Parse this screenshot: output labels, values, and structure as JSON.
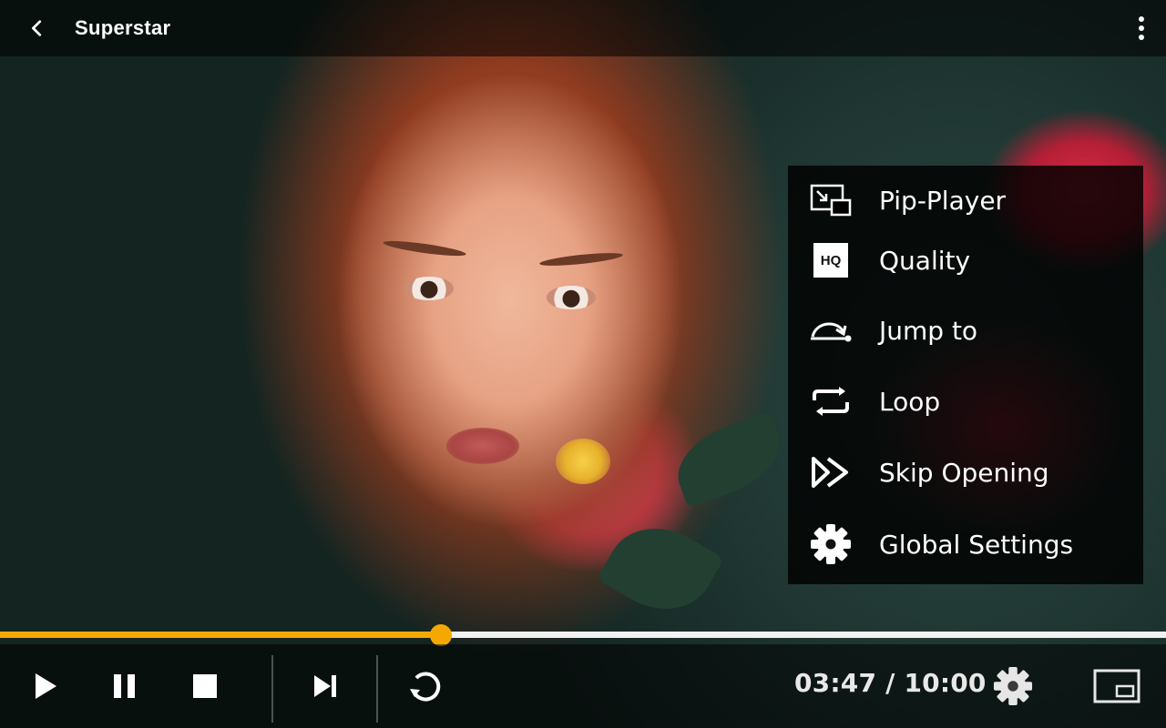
{
  "header": {
    "title": "Superstar",
    "back_icon": "chevron-left-icon",
    "more_icon": "more-vertical-icon"
  },
  "menu": {
    "items": [
      {
        "label": "Pip-Player",
        "icon": "pip-icon"
      },
      {
        "label": "Quality",
        "icon": "hq-icon",
        "badge": "HQ"
      },
      {
        "label": "Jump to",
        "icon": "jump-to-icon"
      },
      {
        "label": "Loop",
        "icon": "loop-icon"
      },
      {
        "label": "Skip Opening",
        "icon": "skip-forward-icon"
      },
      {
        "label": "Global Settings",
        "icon": "gear-icon"
      }
    ]
  },
  "player": {
    "progress_fraction": 0.3783,
    "current_time": "03:47",
    "total_time": "10:00",
    "time_display": "03:47 / 10:00",
    "accent_color": "#f5a900"
  },
  "controls": {
    "icons": [
      "play-icon",
      "pause-icon",
      "stop-icon",
      "next-icon",
      "replay-icon",
      "settings-icon",
      "aspect-ratio-icon"
    ]
  }
}
